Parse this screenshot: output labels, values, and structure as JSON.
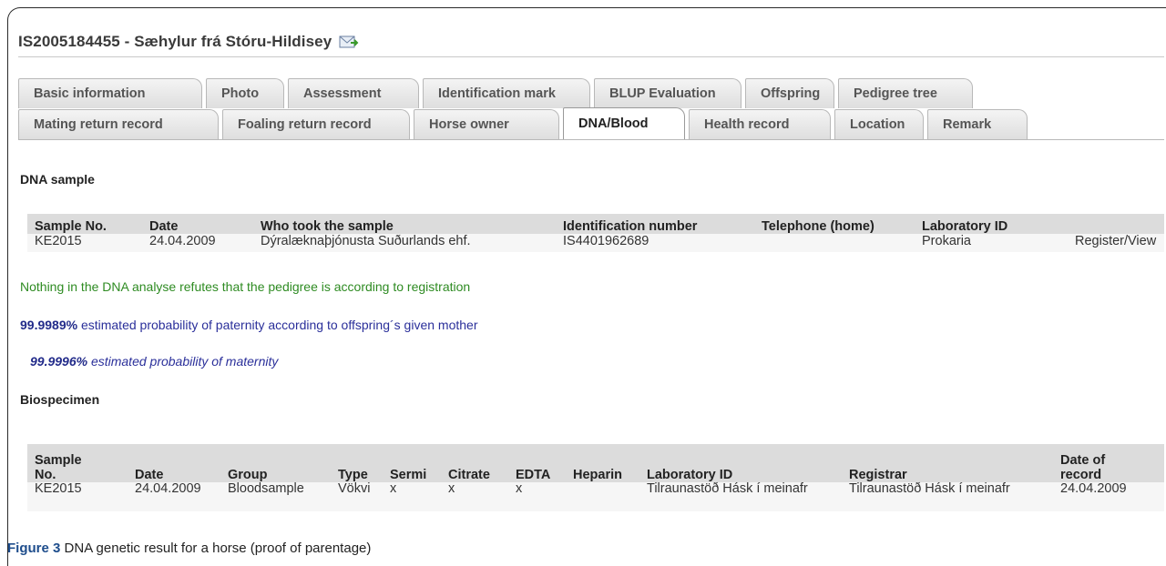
{
  "header": {
    "title": "IS2005184455 - Sæhylur frá Stóru-Hildisey",
    "icon": "mail-forward-icon"
  },
  "tabs": {
    "row1": [
      "Basic information",
      "Photo",
      "Assessment",
      "Identification mark",
      "BLUP Evaluation",
      "Offspring",
      "Pedigree tree"
    ],
    "row2": [
      "Mating return record",
      "Foaling return record",
      "Horse owner",
      "DNA/Blood",
      "Health record",
      "Location",
      "Remark"
    ],
    "active": "DNA/Blood"
  },
  "dna_section": {
    "title": "DNA sample",
    "columns": [
      "Sample No.",
      "Date",
      "Who took the sample",
      "Identification number",
      "Telephone (home)",
      "Laboratory ID",
      ""
    ],
    "row": {
      "sample_no": "KE2015",
      "date": "24.04.2009",
      "who": "Dýralæknaþjónusta Suðurlands ehf.",
      "id_number": "IS4401962689",
      "telephone": "",
      "lab_id": "Prokaria",
      "action": "Register/View"
    }
  },
  "results": {
    "refute_note": "Nothing in the DNA analyse refutes that the pedigree is according to registration",
    "paternity_value": "99.9989%",
    "paternity_text": " estimated probability of paternity according to offspring´s given mother",
    "maternity_value": "99.9996%",
    "maternity_text": " estimated probability of maternity"
  },
  "bio_section": {
    "title": "Biospecimen",
    "columns": {
      "sample_a": "Sample",
      "sample_b": "No.",
      "date": "Date",
      "group": "Group",
      "type": "Type",
      "sermi": "Sermi",
      "citrate": "Citrate",
      "edta": "EDTA",
      "heparin": "Heparin",
      "lab": "Laboratory ID",
      "registrar": "Registrar",
      "record_a": "Date of",
      "record_b": "record"
    },
    "row": {
      "sample_no": "KE2015",
      "date": "24.04.2009",
      "group": "Bloodsample",
      "type": "Vökvi",
      "sermi": "x",
      "citrate": "x",
      "edta": "x",
      "heparin": "",
      "lab": "Tilraunastöð Hásk í meinafr",
      "registrar": "Tilraunastöð Hásk í meinafr",
      "record_date": "24.04.2009"
    }
  },
  "caption": {
    "label": "Figure 3",
    "text": " DNA genetic result for a horse (proof of parentage)"
  }
}
